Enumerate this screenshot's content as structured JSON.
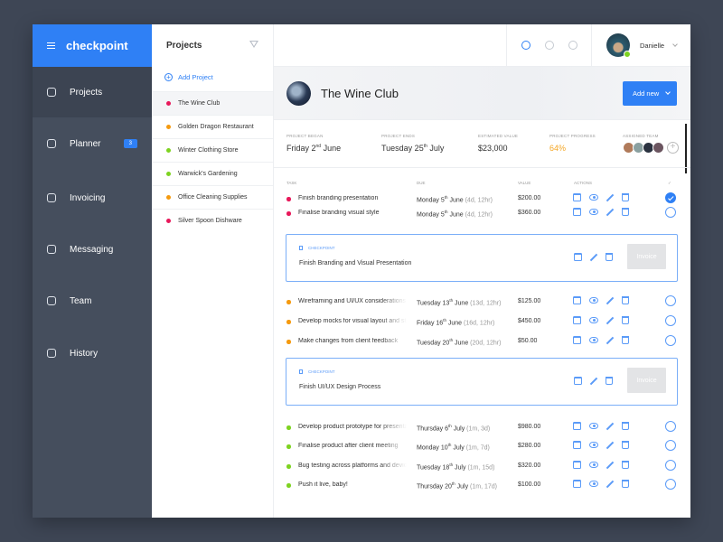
{
  "app": {
    "brand": "checkpoint"
  },
  "sidebar": {
    "items": [
      {
        "label": "Projects",
        "active": true
      },
      {
        "label": "Planner",
        "badge": "3"
      },
      {
        "label": "Invoicing"
      },
      {
        "label": "Messaging"
      },
      {
        "label": "Team"
      },
      {
        "label": "History"
      }
    ]
  },
  "projects": {
    "title": "Projects",
    "add_label": "Add Project",
    "items": [
      {
        "name": "The Wine Club",
        "color": "#e8185a",
        "selected": true
      },
      {
        "name": "Golden Dragon Restaurant",
        "color": "#f59a0f"
      },
      {
        "name": "Winter Clothing Store",
        "color": "#7ed321"
      },
      {
        "name": "Warwick's Gardening",
        "color": "#7ed321"
      },
      {
        "name": "Office Cleaning Supplies",
        "color": "#f59a0f"
      },
      {
        "name": "Silver Spoon Dishware",
        "color": "#e8185a"
      }
    ]
  },
  "user": {
    "name": "Danielle"
  },
  "project": {
    "title": "The Wine Club",
    "add_new": "Add new",
    "began_label": "Project Began",
    "began": {
      "day": "Friday 2",
      "sup": "nd",
      "rest": " June"
    },
    "ends_label": "Project Ends",
    "ends": {
      "day": "Tuesday 25",
      "sup": "th",
      "rest": " July"
    },
    "value_label": "Estimated Value",
    "value": "$23,000",
    "progress_label": "Project Progress",
    "progress": "64%",
    "team_label": "Assigned Team"
  },
  "table": {
    "headers": {
      "task": "Task",
      "due": "Due",
      "value": "Value",
      "actions": "Actions",
      "done": "✓"
    }
  },
  "colors": {
    "accent": "#2f80f5",
    "red": "#e8185a",
    "orange": "#f59a0f",
    "green": "#7ed321"
  },
  "sections": [
    {
      "tasks": [
        {
          "task": "Finish branding presentation",
          "day": "Monday 5",
          "sup": "th",
          "rest": " June",
          "rel": "(4d, 12hr)",
          "value": "$200.00",
          "color": "#e8185a",
          "done": true
        },
        {
          "task": "Finalise branding visual style",
          "day": "Monday 5",
          "sup": "th",
          "rest": " June",
          "rel": "(4d, 12hr)",
          "value": "$360.00",
          "color": "#e8185a",
          "done": false
        }
      ],
      "checkpoint": {
        "label": "Checkpoint",
        "title": "Finish Branding and Visual Presentation",
        "button": "Invoice"
      }
    },
    {
      "tasks": [
        {
          "task": "Wireframing and UI/UX considerations",
          "day": "Tuesday 13",
          "sup": "th",
          "rest": " June",
          "rel": "(13d, 12hr)",
          "value": "$125.00",
          "color": "#f59a0f",
          "done": false
        },
        {
          "task": "Develop mocks for visual layout and style",
          "day": "Friday 16",
          "sup": "th",
          "rest": " June",
          "rel": "(16d, 12hr)",
          "value": "$450.00",
          "color": "#f59a0f",
          "done": false
        },
        {
          "task": "Make changes from client feedback",
          "day": "Tuesday 20",
          "sup": "th",
          "rest": " June",
          "rel": "(20d, 12hr)",
          "value": "$50.00",
          "color": "#f59a0f",
          "done": false
        }
      ],
      "checkpoint": {
        "label": "Checkpoint",
        "title": "Finish UI/UX Design Process",
        "button": "Invoice"
      }
    },
    {
      "tasks": [
        {
          "task": "Develop product prototype for presentation",
          "day": "Thursday 6",
          "sup": "th",
          "rest": " July",
          "rel": "(1m, 3d)",
          "value": "$980.00",
          "color": "#7ed321",
          "done": false
        },
        {
          "task": "Finalise product after client meeting",
          "day": "Monday 10",
          "sup": "th",
          "rest": " July",
          "rel": "(1m, 7d)",
          "value": "$280.00",
          "color": "#7ed321",
          "done": false
        },
        {
          "task": "Bug testing across platforms and devices",
          "day": "Tuesday 18",
          "sup": "th",
          "rest": " July",
          "rel": "(1m, 15d)",
          "value": "$320.00",
          "color": "#7ed321",
          "done": false
        },
        {
          "task": "Push it live, baby!",
          "day": "Thursday 20",
          "sup": "th",
          "rest": " July",
          "rel": "(1m, 17d)",
          "value": "$100.00",
          "color": "#7ed321",
          "done": false
        }
      ]
    }
  ]
}
